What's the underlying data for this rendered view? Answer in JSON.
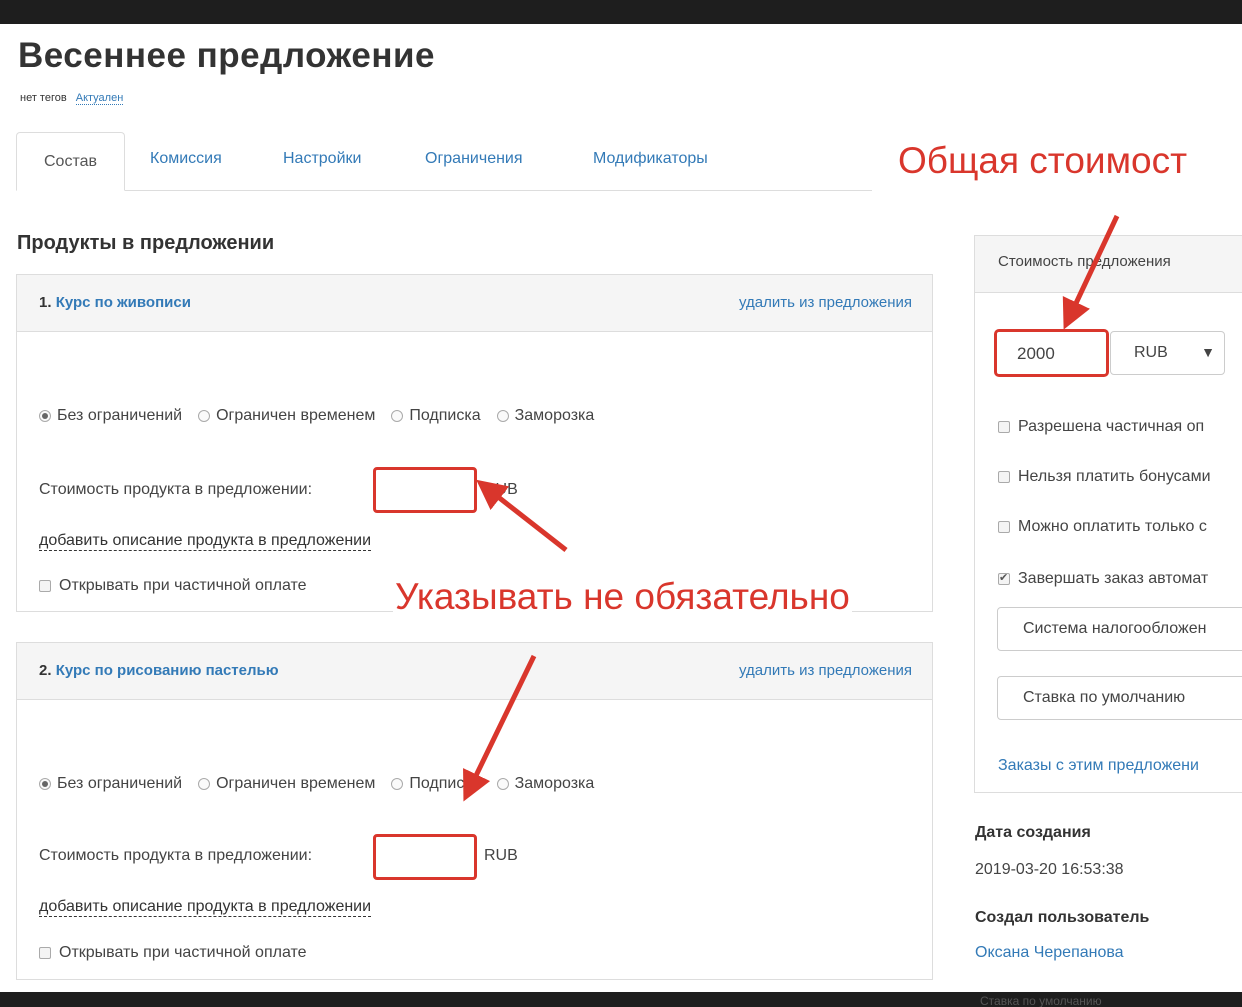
{
  "page": {
    "title": "Весеннее предложение",
    "tags_label": "нет тегов",
    "status": "Актуален"
  },
  "tabs": [
    "Состав",
    "Комиссия",
    "Настройки",
    "Ограничения",
    "Модификаторы"
  ],
  "section_title": "Продукты в предложении",
  "products": [
    {
      "num": "1.",
      "name": "Курс по живописи",
      "remove": "удалить из предложения",
      "access_options": [
        "Без ограничений",
        "Ограничен временем",
        "Подписка",
        "Заморозка"
      ],
      "selected_option": 0,
      "price_label": "Стоимость продукта в предложении:",
      "price_value": "",
      "currency": "RUB",
      "add_description": "добавить описание продукта в предложении",
      "open_on_partial": "Открывать при частичной оплате"
    },
    {
      "num": "2.",
      "name": "Курс по рисованию пастелью",
      "remove": "удалить из предложения",
      "access_options": [
        "Без ограничений",
        "Ограничен временем",
        "Подписка",
        "Заморозка"
      ],
      "selected_option": 0,
      "price_label": "Стоимость продукта в предложении:",
      "price_value": "",
      "currency": "RUB",
      "add_description": "добавить описание продукта в предложении",
      "open_on_partial": "Открывать при частичной оплате"
    }
  ],
  "offer_cost": {
    "header": "Стоимость предложения",
    "amount": "2000",
    "currency": "RUB",
    "options": [
      {
        "label": "Разрешена частичная оп",
        "checked": false
      },
      {
        "label": "Нельзя платить бонусами",
        "checked": false
      },
      {
        "label": "Можно оплатить только с",
        "checked": false
      },
      {
        "label": "Завершать заказ автомат",
        "checked": true
      }
    ],
    "tax_system": "Система налогообложен",
    "vat_rate": "Ставка по умолчанию",
    "orders_link": "Заказы с этим предложени"
  },
  "meta": {
    "created_label": "Дата создания",
    "created_value": "2019-03-20 16:53:38",
    "author_label": "Создал пользователь",
    "author_value": "Оксана Черепанова"
  },
  "annotations": {
    "total_cost": "Общая стоимост",
    "optional": "Указывать не обязательно"
  },
  "bottom_ghost": "Ставка по умолчанию",
  "colors": {
    "accent_red": "#d9362c",
    "link_blue": "#337ab7"
  }
}
